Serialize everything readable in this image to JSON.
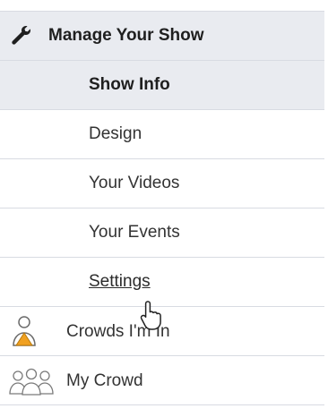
{
  "nav": {
    "header": {
      "label": "Manage Your Show",
      "icon": "wrench-icon"
    },
    "sub_items": [
      {
        "label": "Show Info",
        "selected": true
      },
      {
        "label": "Design"
      },
      {
        "label": "Your Videos"
      },
      {
        "label": "Your Events"
      },
      {
        "label": "Settings",
        "hovered": true
      }
    ],
    "crowds_im_in": {
      "label": "Crowds I'm In",
      "icon": "person-warning-icon"
    },
    "my_crowd": {
      "label": "My Crowd",
      "icon": "group-icon"
    }
  },
  "colors": {
    "header_bg": "#e9ebf0",
    "divider": "#d8dbe2",
    "text": "#333333",
    "warning_accent": "#f0a020"
  }
}
